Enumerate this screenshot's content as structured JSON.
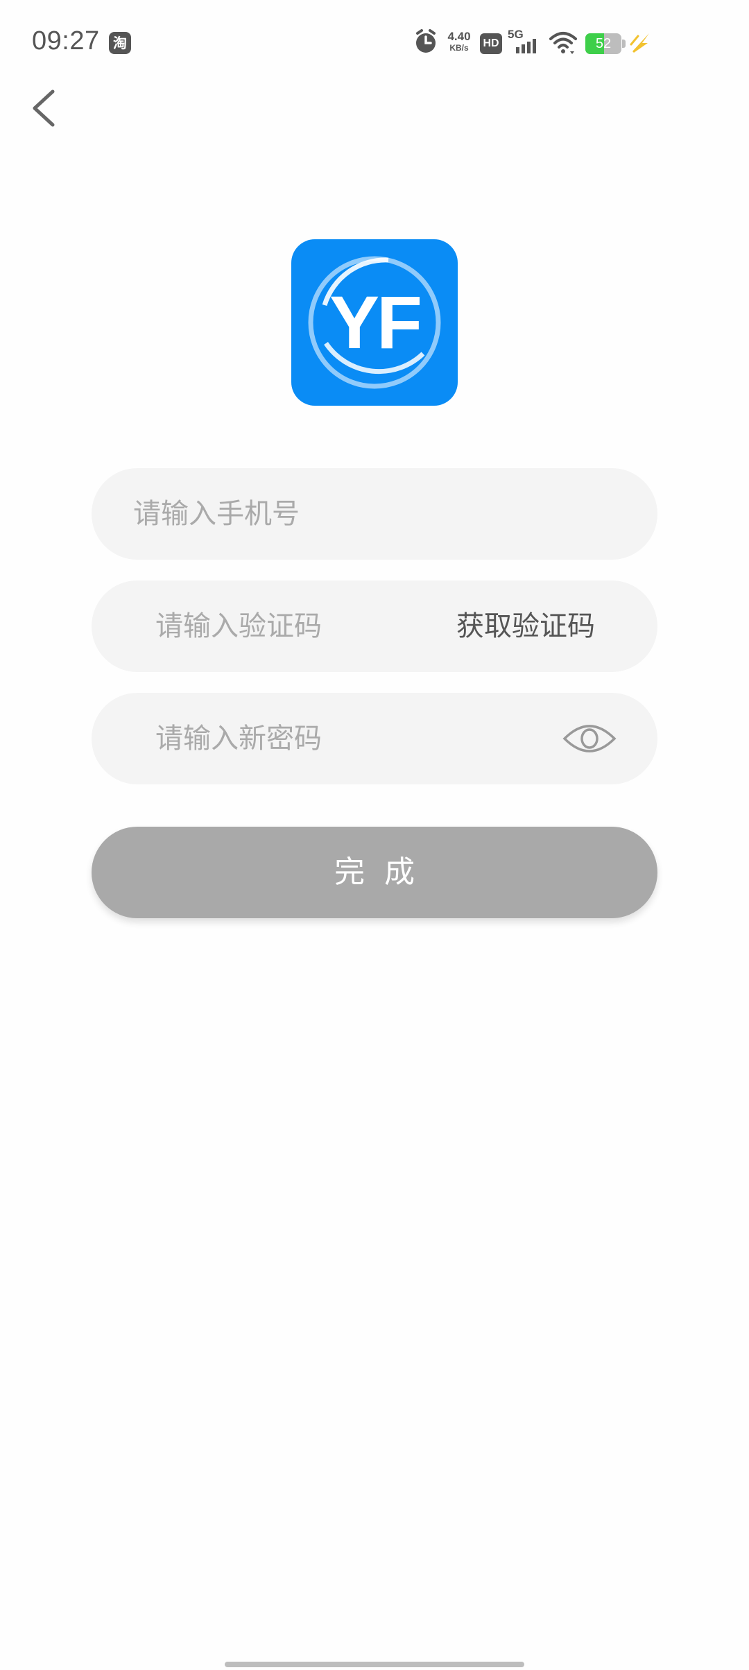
{
  "status_bar": {
    "time": "09:27",
    "taobao_badge": "淘",
    "net_speed_value": "4.40",
    "net_speed_unit": "KB/s",
    "hd_label": "HD",
    "network_type": "5G",
    "battery_level": "52",
    "battery_fraction": 0.52,
    "battery_color": "#3ecf4a",
    "icons": [
      "alarm-icon",
      "signal-icon",
      "wifi-icon",
      "charging-icon"
    ]
  },
  "nav": {
    "back_icon": "chevron-left-icon"
  },
  "logo": {
    "text": "YF",
    "background": "#0a8cf5"
  },
  "form": {
    "phone_placeholder": "请输入手机号",
    "code_placeholder": "请输入验证码",
    "get_code_label": "获取验证码",
    "password_placeholder": "请输入新密码",
    "visibility_icon": "eye-icon",
    "submit_label": "完成"
  }
}
